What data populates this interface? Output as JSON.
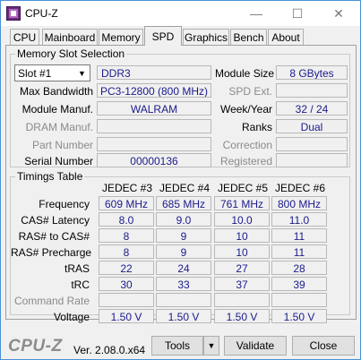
{
  "window": {
    "title": "CPU-Z",
    "minimize": "—",
    "maximize": "☐",
    "close": "✕"
  },
  "tabs": [
    {
      "label": "CPU"
    },
    {
      "label": "Mainboard"
    },
    {
      "label": "Memory"
    },
    {
      "label": "SPD"
    },
    {
      "label": "Graphics"
    },
    {
      "label": "Bench"
    },
    {
      "label": "About"
    }
  ],
  "memory_slot": {
    "title": "Memory Slot Selection",
    "slot_value": "Slot #1",
    "type": "DDR3",
    "module_size_label": "Module Size",
    "module_size": "8 GBytes",
    "max_bandwidth_label": "Max Bandwidth",
    "max_bandwidth": "PC3-12800 (800 MHz)",
    "spd_ext_label": "SPD Ext.",
    "spd_ext": "",
    "module_manuf_label": "Module Manuf.",
    "module_manuf": "WALRAM",
    "week_year_label": "Week/Year",
    "week_year": "32 / 24",
    "dram_manuf_label": "DRAM Manuf.",
    "dram_manuf": "",
    "ranks_label": "Ranks",
    "ranks": "Dual",
    "part_number_label": "Part Number",
    "part_number": "",
    "correction_label": "Correction",
    "correction": "",
    "serial_number_label": "Serial Number",
    "serial_number": "00000136",
    "registered_label": "Registered",
    "registered": ""
  },
  "timings": {
    "title": "Timings Table",
    "columns": [
      "JEDEC #3",
      "JEDEC #4",
      "JEDEC #5",
      "JEDEC #6"
    ],
    "rows": [
      {
        "label": "Frequency",
        "values": [
          "609 MHz",
          "685 MHz",
          "761 MHz",
          "800 MHz"
        ]
      },
      {
        "label": "CAS# Latency",
        "values": [
          "8.0",
          "9.0",
          "10.0",
          "11.0"
        ]
      },
      {
        "label": "RAS# to CAS#",
        "values": [
          "8",
          "9",
          "10",
          "11"
        ]
      },
      {
        "label": "RAS# Precharge",
        "values": [
          "8",
          "9",
          "10",
          "11"
        ]
      },
      {
        "label": "tRAS",
        "values": [
          "22",
          "24",
          "27",
          "28"
        ]
      },
      {
        "label": "tRC",
        "values": [
          "30",
          "33",
          "37",
          "39"
        ]
      },
      {
        "label": "Command Rate",
        "values": [
          "",
          "",
          "",
          ""
        ]
      },
      {
        "label": "Voltage",
        "values": [
          "1.50 V",
          "1.50 V",
          "1.50 V",
          "1.50 V"
        ]
      }
    ]
  },
  "footer": {
    "logo": "CPU-Z",
    "version": "Ver. 2.08.0.x64",
    "tools_label": "Tools",
    "validate_label": "Validate",
    "close_label": "Close"
  },
  "colors": {
    "value_text": "#1a1a8c",
    "disabled_label": "#8a8a8a",
    "window_border": "#4a90d9"
  },
  "icons": {
    "app": "cpu-z-app-icon",
    "dropdown": "chevron-down-icon"
  }
}
